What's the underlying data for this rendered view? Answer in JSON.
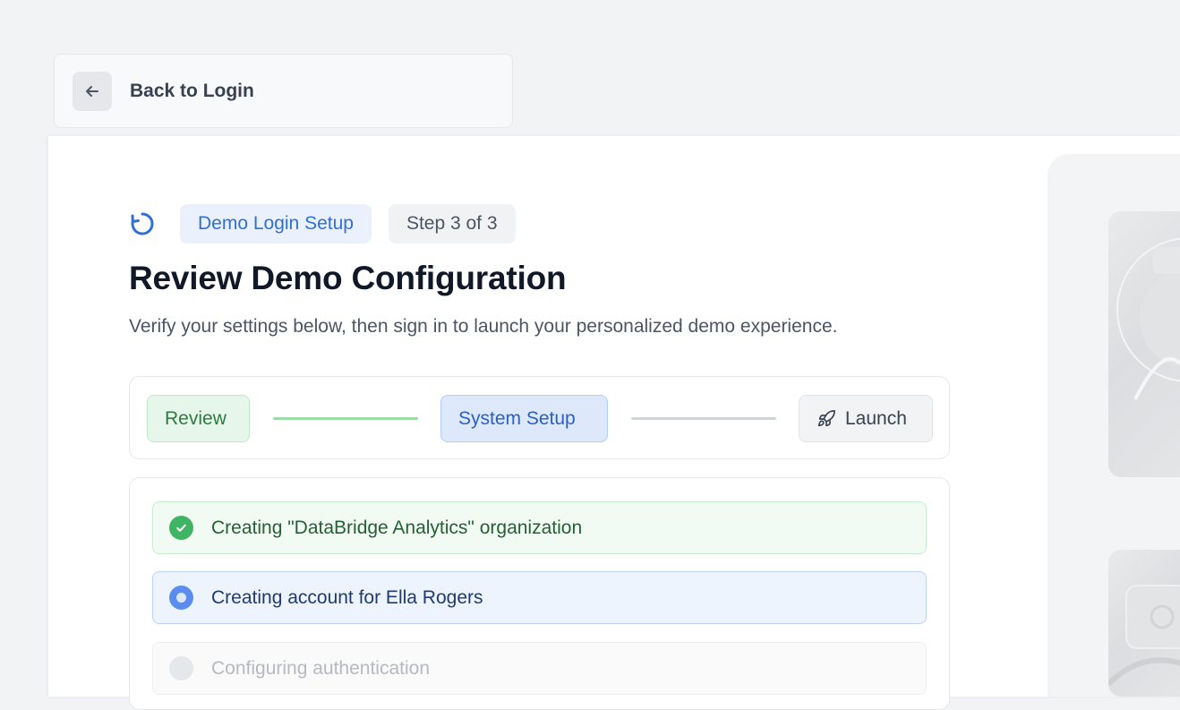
{
  "nav": {
    "back_label": "Back to Login",
    "back_icon": "arrow-left-icon"
  },
  "header": {
    "badge_label": "Demo Login Setup",
    "step_label": "Step 3 of 3",
    "title": "Review Demo Configuration",
    "subtitle": "Verify your settings below, then sign in to launch your personalized demo experience."
  },
  "stepper": {
    "steps": [
      {
        "label": "Review",
        "state": "complete"
      },
      {
        "label": "System Setup",
        "state": "current"
      },
      {
        "label": "Launch",
        "state": "upcoming",
        "icon": "rocket-icon"
      }
    ]
  },
  "tasks": [
    {
      "label": "Creating \"DataBridge Analytics\" organization",
      "state": "done",
      "icon": "check-circle-icon"
    },
    {
      "label": "Creating account for Ella Rogers",
      "state": "in-progress",
      "icon": "radio-active-icon"
    },
    {
      "label": "Configuring authentication",
      "state": "pending",
      "icon": "pending-circle-icon"
    }
  ],
  "colors": {
    "accent_blue": "#2f6fd6",
    "success_green": "#3fb564",
    "active_blue": "#5b8def",
    "pending_gray": "#e5e7eb"
  }
}
